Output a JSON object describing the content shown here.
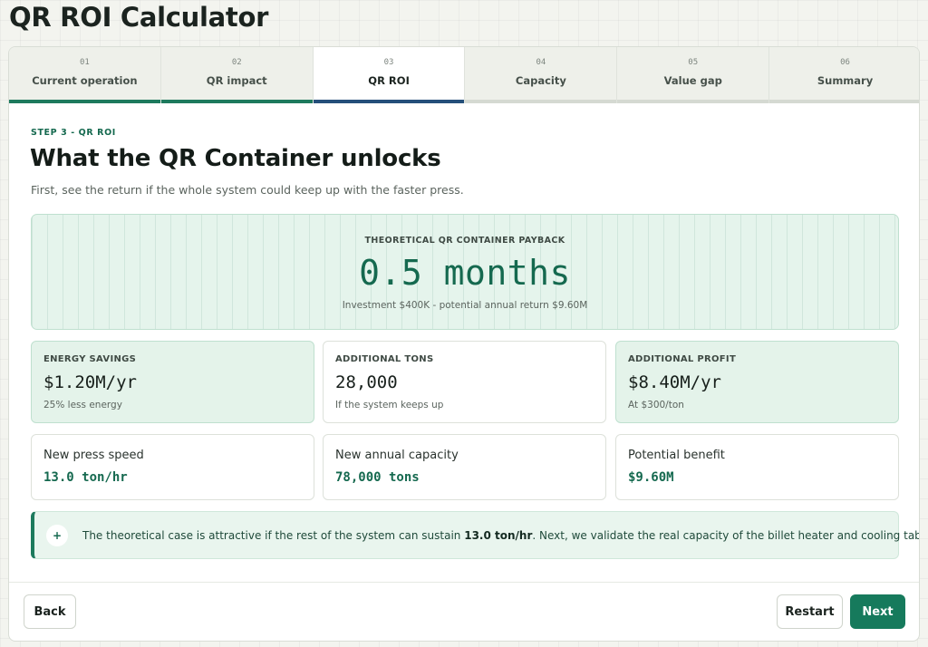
{
  "app": {
    "title": "QR ROI Calculator"
  },
  "tabs": [
    {
      "num": "01",
      "label": "Current operation",
      "state": "done"
    },
    {
      "num": "02",
      "label": "QR impact",
      "state": "done"
    },
    {
      "num": "03",
      "label": "QR ROI",
      "state": "active"
    },
    {
      "num": "04",
      "label": "Capacity",
      "state": "pending"
    },
    {
      "num": "05",
      "label": "Value gap",
      "state": "pending"
    },
    {
      "num": "06",
      "label": "Summary",
      "state": "pending"
    }
  ],
  "step": {
    "label": "STEP 3 - QR ROI",
    "title": "What the QR Container unlocks",
    "subtitle": "First, see the return if the whole system could keep up with the faster press."
  },
  "hero": {
    "label": "THEORETICAL QR CONTAINER PAYBACK",
    "value": "0.5 months",
    "note": "Investment $400K - potential annual return $9.60M"
  },
  "metrics": [
    {
      "label": "ENERGY SAVINGS",
      "value": "$1.20M/yr",
      "note": "25% less energy",
      "highlight": true
    },
    {
      "label": "ADDITIONAL TONS",
      "value": "28,000",
      "note": "If the system keeps up",
      "highlight": false
    },
    {
      "label": "ADDITIONAL PROFIT",
      "value": "$8.40M/yr",
      "note": "At $300/ton",
      "highlight": true
    }
  ],
  "stats": [
    {
      "label": "New press speed",
      "value": "13.0 ton/hr"
    },
    {
      "label": "New annual capacity",
      "value": "78,000 tons"
    },
    {
      "label": "Potential benefit",
      "value": "$9.60M"
    }
  ],
  "info": {
    "icon": "plus-icon",
    "text_before": "The theoretical case is attractive if the rest of the system can sustain ",
    "text_bold": "13.0 ton/hr",
    "text_after": ". Next, we validate the real capacity of the billet heater and cooling table."
  },
  "footer": {
    "back_label": "Back",
    "restart_label": "Restart",
    "next_label": "Next"
  },
  "colors": {
    "accent": "#167a5c",
    "active_tab_bar": "#244f7a",
    "highlight_bg": "#e4f3ea"
  }
}
